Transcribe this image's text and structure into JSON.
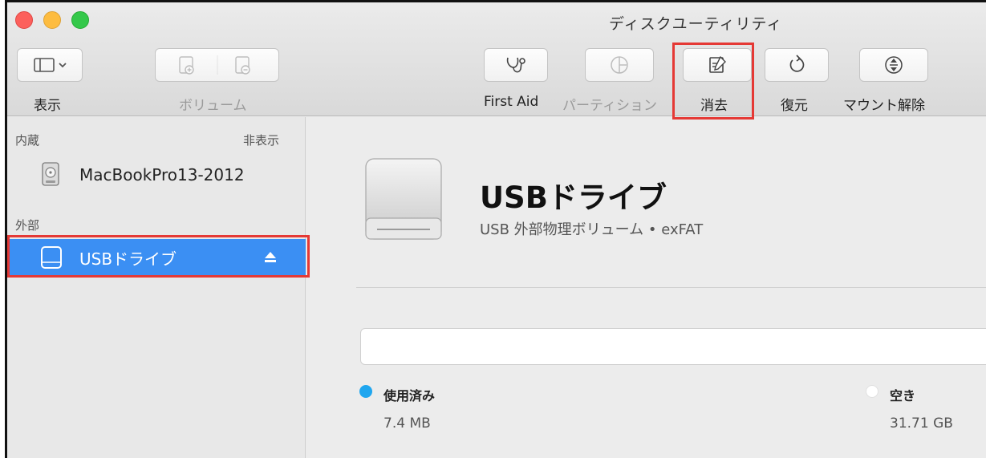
{
  "window": {
    "title": "ディスクユーティリティ"
  },
  "toolbar": {
    "view_label": "表示",
    "volume_label": "ボリューム",
    "first_aid_label": "First Aid",
    "partition_label": "パーティション",
    "erase_label": "消去",
    "restore_label": "復元",
    "unmount_label": "マウント解除"
  },
  "sidebar": {
    "internal_label": "内蔵",
    "hide_label": "非表示",
    "external_label": "外部",
    "internal_disks": [
      {
        "name": "MacBookPro13-2012",
        "icon": "hard-drive-icon"
      }
    ],
    "external_disks": [
      {
        "name": "USBドライブ",
        "icon": "usb-drive-icon",
        "selected": true,
        "eject_icon": "eject-icon"
      }
    ]
  },
  "main": {
    "title": "USBドライブ",
    "subtitle": "USB 外部物理ボリューム • exFAT",
    "usage": {
      "used_label": "使用済み",
      "used_value": "7.4 MB",
      "used_color": "#1fa6ef",
      "free_label": "空き",
      "free_value": "31.71 GB",
      "free_color": "#ffffff"
    }
  },
  "colors": {
    "selection": "#3b8ff3",
    "highlight_box": "#e53935"
  }
}
